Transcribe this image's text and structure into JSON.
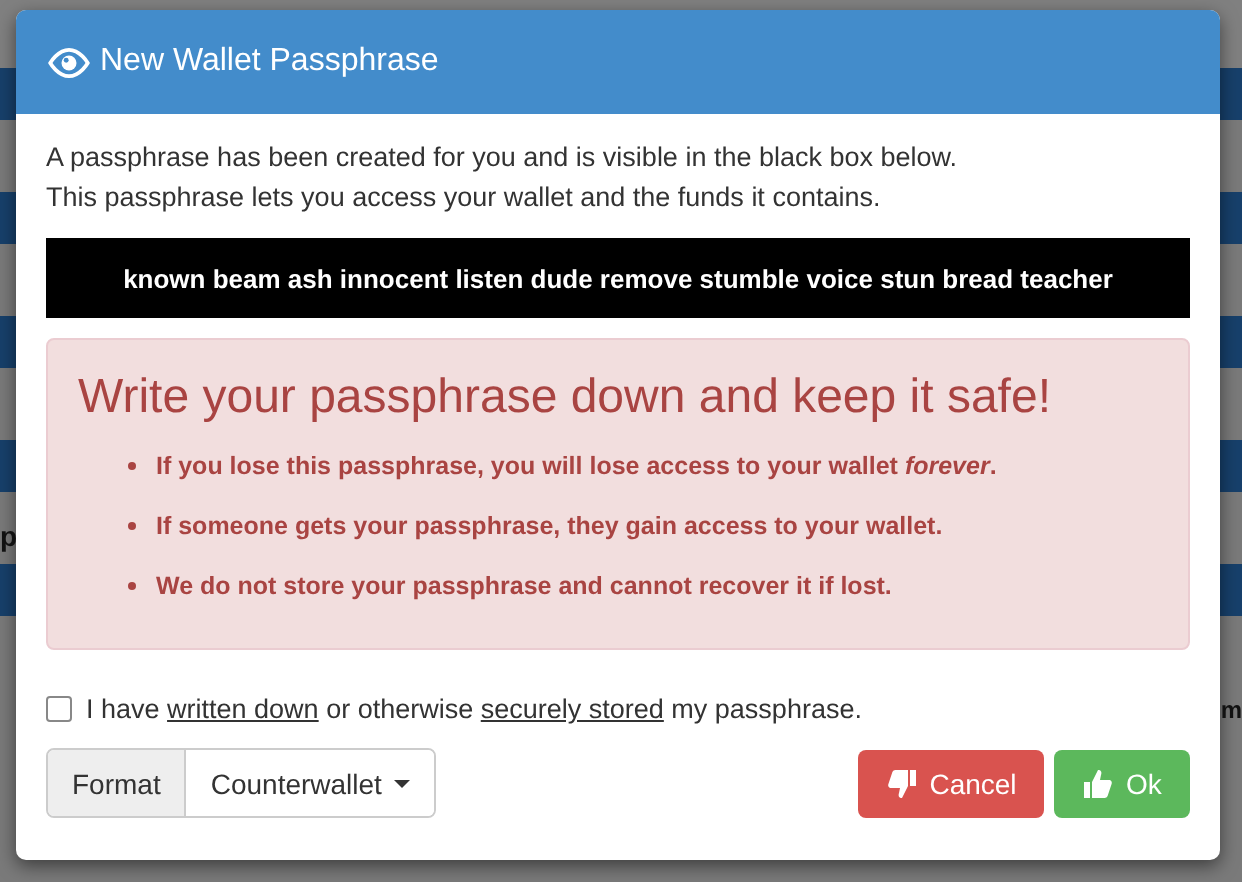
{
  "background": {
    "left_text": "p",
    "right_text": "m"
  },
  "dialog": {
    "title": "New Wallet Passphrase",
    "intro": [
      "A passphrase has been created for you and is visible in the black box below.",
      "This passphrase lets you access your wallet and the funds it contains."
    ],
    "passphrase": "known beam ash innocent listen dude remove stumble voice stun bread teacher",
    "warning": {
      "heading": "Write your passphrase down and keep it safe!",
      "bullets": [
        "If you lose this passphrase, you will lose access to your wallet *forever*.",
        "If someone gets your passphrase, they gain access to your wallet.",
        "We do not store your passphrase and cannot recover it if lost."
      ]
    },
    "confirm": {
      "checked": false,
      "parts": [
        {
          "text": "I have ",
          "underline": false
        },
        {
          "text": "written down",
          "underline": true
        },
        {
          "text": " or otherwise ",
          "underline": false
        },
        {
          "text": "securely stored",
          "underline": true
        },
        {
          "text": " my passphrase.",
          "underline": false
        }
      ]
    },
    "format": {
      "label": "Format",
      "value": "Counterwallet"
    },
    "buttons": [
      {
        "label": "Cancel",
        "kind": "cancel"
      },
      {
        "label": "Ok",
        "kind": "ok"
      }
    ]
  }
}
